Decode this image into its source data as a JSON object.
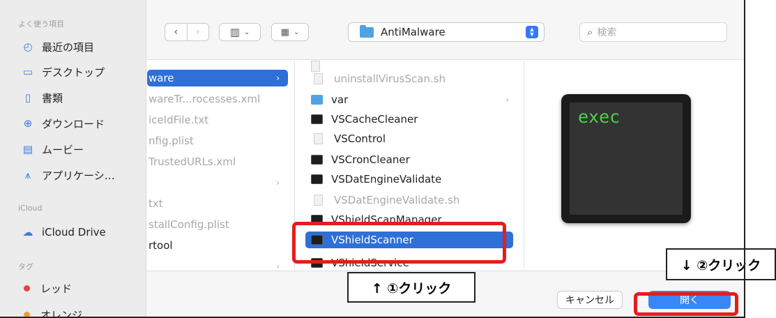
{
  "sidebar": {
    "favorites_heading": "よく使う項目",
    "favorites": [
      {
        "icon": "clock-icon",
        "label": "最近の項目"
      },
      {
        "icon": "desktop-icon",
        "label": "デスクトップ"
      },
      {
        "icon": "document-icon",
        "label": "書類"
      },
      {
        "icon": "download-icon",
        "label": "ダウンロード"
      },
      {
        "icon": "film-icon",
        "label": "ムービー"
      },
      {
        "icon": "applications-icon",
        "label": "アプリケーシ…"
      }
    ],
    "icloud_heading": "iCloud",
    "icloud_items": [
      {
        "icon": "cloud-icon",
        "label": "iCloud Drive"
      }
    ],
    "tags_heading": "タグ",
    "tags": [
      {
        "label": "レッド",
        "color": "#e8413b"
      },
      {
        "label": "オレンジ",
        "color": "#f29a2e"
      }
    ]
  },
  "toolbar": {
    "back_icon": "chevron-left-icon",
    "forward_icon": "chevron-right-icon",
    "view_icon": "columns-view-icon",
    "group_icon": "grid-group-icon",
    "location": "AntiMalware",
    "search_placeholder": "検索"
  },
  "column1": {
    "items": [
      {
        "label": "ware",
        "selected": true,
        "dim": false,
        "chevron": true
      },
      {
        "label": "wareTr...rocesses.xml",
        "selected": false,
        "dim": true,
        "chevron": false
      },
      {
        "label": "iceIdFile.txt",
        "selected": false,
        "dim": true,
        "chevron": false
      },
      {
        "label": "nfig.plist",
        "selected": false,
        "dim": true,
        "chevron": false
      },
      {
        "label": "TrustedURLs.xml",
        "selected": false,
        "dim": true,
        "chevron": false
      },
      {
        "label": "",
        "selected": false,
        "dim": true,
        "chevron": true
      },
      {
        "label": "txt",
        "selected": false,
        "dim": true,
        "chevron": false
      },
      {
        "label": "stallConfig.plist",
        "selected": false,
        "dim": true,
        "chevron": false
      },
      {
        "label": "rtool",
        "selected": false,
        "dim": false,
        "chevron": false
      }
    ]
  },
  "column2": {
    "items": [
      {
        "label": "uninstallVirusScan.sh",
        "type": "doc",
        "dim": true,
        "selected": false
      },
      {
        "label": "var",
        "type": "folder",
        "dim": false,
        "selected": false,
        "chevron": true
      },
      {
        "label": "VSCacheCleaner",
        "type": "term",
        "dim": false,
        "selected": false
      },
      {
        "label": "VSControl",
        "type": "doc",
        "dim": false,
        "selected": false
      },
      {
        "label": "VSCronCleaner",
        "type": "term",
        "dim": false,
        "selected": false
      },
      {
        "label": "VSDatEngineValidate",
        "type": "term",
        "dim": false,
        "selected": false
      },
      {
        "label": "VSDatEngineValidate.sh",
        "type": "doc",
        "dim": true,
        "selected": false
      },
      {
        "label": "VShieldScanManager",
        "type": "term",
        "dim": false,
        "selected": false
      },
      {
        "label": "VShieldScanner",
        "type": "term",
        "dim": false,
        "selected": true
      },
      {
        "label": "VShieldService",
        "type": "term",
        "dim": false,
        "selected": false
      }
    ]
  },
  "preview": {
    "terminal_text": "exec"
  },
  "buttons": {
    "cancel": "キャンセル",
    "open": "開く"
  },
  "annotations": {
    "step1": "↑ ①クリック",
    "step2": "↓ ②クリック",
    "highlight_color": "#e51d1d"
  }
}
